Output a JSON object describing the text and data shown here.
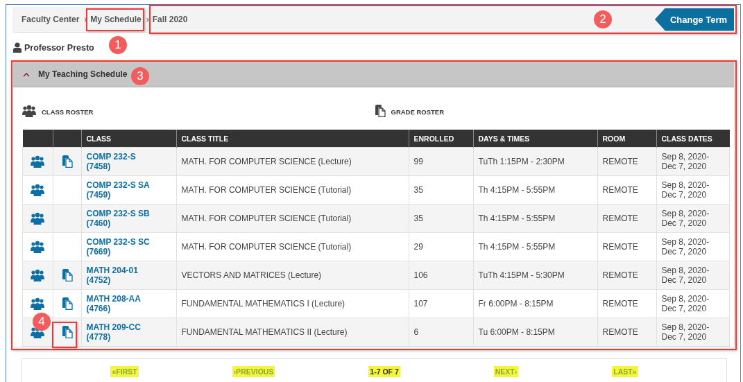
{
  "breadcrumb": [
    {
      "label": "Faculty Center"
    },
    {
      "separator": "›",
      "label": "My Schedule"
    },
    {
      "separator": "›",
      "label": "Fall 2020"
    }
  ],
  "change_term_button": "Change Term",
  "user_name": "Professor Presto",
  "section": {
    "title": "My Teaching Schedule",
    "expanded": true
  },
  "roster_links": [
    {
      "kind": "class",
      "label": "CLASS ROSTER"
    },
    {
      "kind": "grade",
      "label": "GRADE ROSTER"
    }
  ],
  "table": {
    "columns": [
      "CLASS",
      "CLASS TITLE",
      "ENROLLED",
      "DAYS & TIMES",
      "ROOM",
      "CLASS DATES"
    ],
    "rows": [
      {
        "class": "COMP 232-S",
        "class_number": "(7458)",
        "title": "MATH. FOR COMPUTER SCIENCE (Lecture)",
        "enrolled": "99",
        "days_times": "TuTh 1:15PM - 2:30PM",
        "room": "REMOTE",
        "date_start": "Sep 8, 2020-",
        "date_end": "Dec 7, 2020",
        "grade_roster": true
      },
      {
        "class": "COMP 232-S SA",
        "class_number": "(7459)",
        "title": "MATH. FOR COMPUTER SCIENCE (Tutorial)",
        "enrolled": "35",
        "days_times": "Th 4:15PM - 5:55PM",
        "room": "REMOTE",
        "date_start": "Sep 8, 2020-",
        "date_end": "Dec 7, 2020",
        "grade_roster": false
      },
      {
        "class": "COMP 232-S SB",
        "class_number": "(7460)",
        "title": "MATH. FOR COMPUTER SCIENCE (Tutorial)",
        "enrolled": "35",
        "days_times": "Th 4:15PM - 5:55PM",
        "room": "REMOTE",
        "date_start": "Sep 8, 2020-",
        "date_end": "Dec 7, 2020",
        "grade_roster": false
      },
      {
        "class": "COMP 232-S SC",
        "class_number": "(7669)",
        "title": "MATH. FOR COMPUTER SCIENCE (Tutorial)",
        "enrolled": "29",
        "days_times": "Th 4:15PM - 5:55PM",
        "room": "REMOTE",
        "date_start": "Sep 8, 2020-",
        "date_end": "Dec 7, 2020",
        "grade_roster": false
      },
      {
        "class": "MATH 204-01",
        "class_number": "(4752)",
        "title": "VECTORS AND MATRICES (Lecture)",
        "enrolled": "106",
        "days_times": "TuTh 4:15PM - 5:30PM",
        "room": "REMOTE",
        "date_start": "Sep 8, 2020-",
        "date_end": "Dec 7, 2020",
        "grade_roster": true
      },
      {
        "class": "MATH 208-AA",
        "class_number": "(4766)",
        "title": "FUNDAMENTAL MATHEMATICS I (Lecture)",
        "enrolled": "107",
        "days_times": "Fr 6:00PM - 8:15PM",
        "room": "REMOTE",
        "date_start": "Sep 8, 2020-",
        "date_end": "Dec 7, 2020",
        "grade_roster": true
      },
      {
        "class": "MATH 209-CC",
        "class_number": "(4778)",
        "title": "FUNDAMENTAL MATHEMATICS II (Lecture)",
        "enrolled": "6",
        "days_times": "Tu 6:00PM - 8:15PM",
        "room": "REMOTE",
        "date_start": "Sep 8, 2020-",
        "date_end": "Dec 7, 2020",
        "grade_roster": true
      }
    ]
  },
  "pagination": {
    "first": {
      "glyph": "«",
      "label": "FIRST"
    },
    "previous": {
      "glyph": "‹",
      "label": "PREVIOUS"
    },
    "range": "1-7 OF 7",
    "next": {
      "glyph": "›",
      "label": "NEXT"
    },
    "last": {
      "glyph": "»",
      "label": "LAST"
    }
  },
  "callouts": [
    {
      "label": "1"
    },
    {
      "label": "2"
    },
    {
      "label": "3"
    },
    {
      "label": "4"
    }
  ]
}
